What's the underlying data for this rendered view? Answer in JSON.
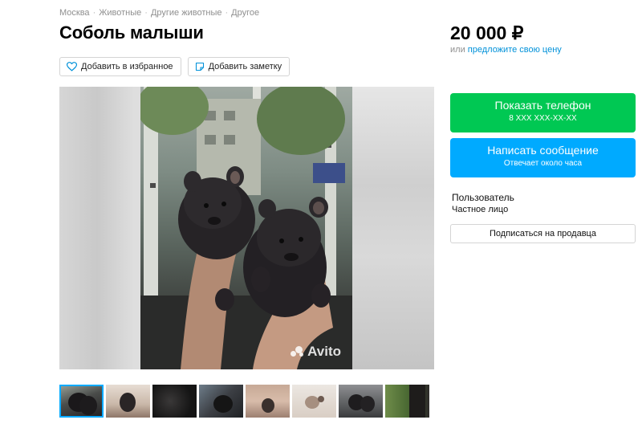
{
  "breadcrumbs": [
    "Москва",
    "Животные",
    "Другие животные",
    "Другое"
  ],
  "breadcrumb_separator": "·",
  "listing": {
    "title": "Соболь малыши",
    "price": "20 000 ₽",
    "offer_prefix": "или",
    "offer_link": "предложите свою цену"
  },
  "actions": {
    "favorite_label": "Добавить в избранное",
    "note_label": "Добавить заметку"
  },
  "gallery": {
    "watermark": "Avito",
    "thumbnails_count": 8,
    "active_thumbnail": 1
  },
  "contact": {
    "phone_label": "Показать телефон",
    "phone_masked": "8 XXX XXX-XX-XX",
    "message_label": "Написать сообщение",
    "message_sub": "Отвечает около часа"
  },
  "seller": {
    "name": "Пользователь",
    "type": "Частное лицо",
    "subscribe_label": "Подписаться на продавца"
  },
  "colors": {
    "phone_button": "#00c853",
    "message_button": "#00aaff",
    "link": "#0091d9"
  }
}
